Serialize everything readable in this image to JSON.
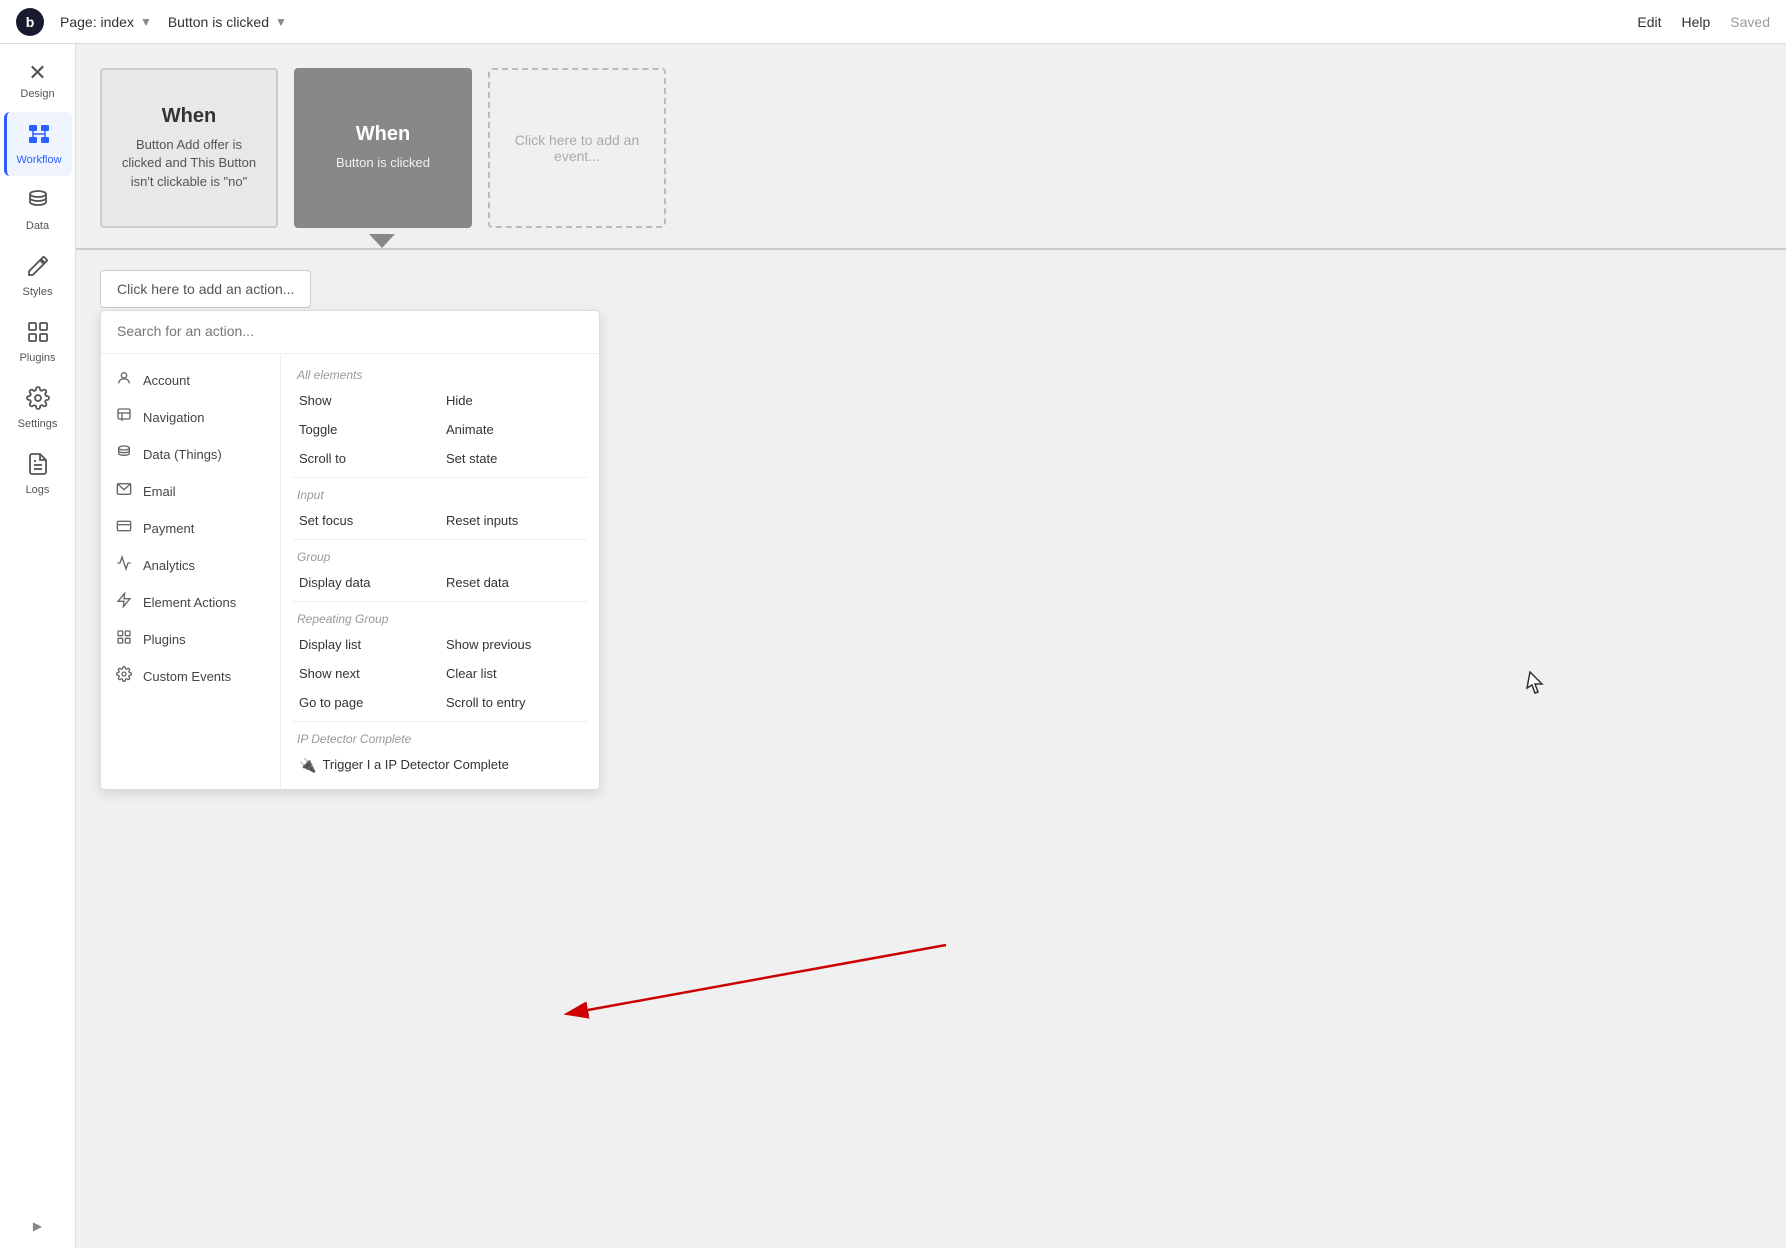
{
  "topbar": {
    "logo": "b",
    "page_label": "Page: index",
    "dropdown_icon": "▼",
    "workflow_label": "Button is clicked",
    "edit_label": "Edit",
    "help_label": "Help",
    "saved_label": "Saved"
  },
  "sidebar": {
    "items": [
      {
        "id": "design",
        "label": "Design",
        "icon": "✕"
      },
      {
        "id": "workflow",
        "label": "Workflow",
        "icon": "🔷",
        "active": true
      },
      {
        "id": "data",
        "label": "Data",
        "icon": "🗄"
      },
      {
        "id": "styles",
        "label": "Styles",
        "icon": "✏️"
      },
      {
        "id": "plugins",
        "label": "Plugins",
        "icon": "🧩"
      },
      {
        "id": "settings",
        "label": "Settings",
        "icon": "⚙️"
      },
      {
        "id": "logs",
        "label": "Logs",
        "icon": "📄"
      }
    ],
    "collapse_icon": "▶"
  },
  "event_cards": [
    {
      "id": "card1",
      "style": "light",
      "when_label": "When",
      "description": "Button Add offer is clicked and This Button isn't clickable is \"no\""
    },
    {
      "id": "card2",
      "style": "dark",
      "when_label": "When",
      "description": "Button is clicked"
    },
    {
      "id": "card3",
      "style": "dashed",
      "placeholder": "Click here to add an event..."
    }
  ],
  "actions": {
    "add_action_label": "Click here to add an action...",
    "search_placeholder": "Search for an action...",
    "categories": [
      {
        "id": "account",
        "icon": "👤",
        "label": "Account"
      },
      {
        "id": "navigation",
        "icon": "↗",
        "label": "Navigation"
      },
      {
        "id": "data",
        "icon": "🗄",
        "label": "Data (Things)"
      },
      {
        "id": "email",
        "icon": "✉️",
        "label": "Email"
      },
      {
        "id": "payment",
        "icon": "💳",
        "label": "Payment"
      },
      {
        "id": "analytics",
        "icon": "📊",
        "label": "Analytics"
      },
      {
        "id": "element-actions",
        "icon": "⚡",
        "label": "Element Actions"
      },
      {
        "id": "plugins",
        "icon": "🔧",
        "label": "Plugins"
      },
      {
        "id": "custom-events",
        "icon": "⚙️",
        "label": "Custom Events"
      }
    ],
    "sections": [
      {
        "title": "All elements",
        "items": [
          {
            "id": "show",
            "label": "Show",
            "col": 1
          },
          {
            "id": "hide",
            "label": "Hide",
            "col": 2
          },
          {
            "id": "toggle",
            "label": "Toggle",
            "col": 1
          },
          {
            "id": "animate",
            "label": "Animate",
            "col": 2
          },
          {
            "id": "scroll-to",
            "label": "Scroll to",
            "col": 1
          },
          {
            "id": "set-state",
            "label": "Set state",
            "col": 2
          }
        ]
      },
      {
        "title": "Input",
        "items": [
          {
            "id": "set-focus",
            "label": "Set focus",
            "col": 1
          },
          {
            "id": "reset-inputs",
            "label": "Reset inputs",
            "col": 2
          }
        ]
      },
      {
        "title": "Group",
        "items": [
          {
            "id": "display-data",
            "label": "Display data",
            "col": 1
          },
          {
            "id": "reset-data",
            "label": "Reset data",
            "col": 2
          }
        ]
      },
      {
        "title": "Repeating Group",
        "items": [
          {
            "id": "display-list",
            "label": "Display list",
            "col": 1
          },
          {
            "id": "show-previous",
            "label": "Show previous",
            "col": 2
          },
          {
            "id": "show-next",
            "label": "Show next",
            "col": 1
          },
          {
            "id": "clear-list",
            "label": "Clear list",
            "col": 2
          },
          {
            "id": "go-to-page",
            "label": "Go to page",
            "col": 1
          },
          {
            "id": "scroll-to-entry",
            "label": "Scroll to entry",
            "col": 2
          }
        ]
      },
      {
        "title": "IP Detector Complete",
        "items": [
          {
            "id": "trigger-ip",
            "label": "Trigger I a IP Detector Complete",
            "col": 1,
            "special": true
          }
        ]
      }
    ]
  }
}
